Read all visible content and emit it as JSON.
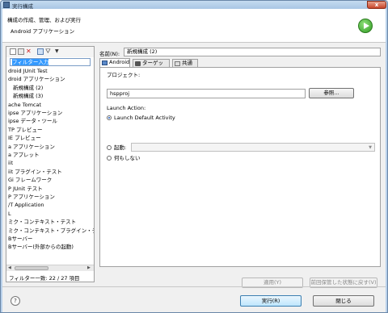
{
  "window": {
    "title": "実行構成",
    "close_symbol": "x"
  },
  "header": {
    "title": "構成の作成、管理、および実行",
    "subtitle": "Android アプリケーション"
  },
  "left": {
    "filter_placeholder": "フィルター入力",
    "tree_items": [
      {
        "label": "droid JUnit Test",
        "sub": false
      },
      {
        "label": "droid アプリケーション",
        "sub": false
      },
      {
        "label": "新規構成 (2)",
        "sub": true
      },
      {
        "label": "新規構成 (3)",
        "sub": true
      },
      {
        "label": "ache Tomcat",
        "sub": false
      },
      {
        "label": "ipse アプリケーション",
        "sub": false
      },
      {
        "label": "ipse データ・ツール",
        "sub": false
      },
      {
        "label": "TP プレビュー",
        "sub": false
      },
      {
        "label": "IE プレビュー",
        "sub": false
      },
      {
        "label": "a アプリケーション",
        "sub": false
      },
      {
        "label": "a アプレット",
        "sub": false
      },
      {
        "label": "iit",
        "sub": false
      },
      {
        "label": "iit プラグイン・テスト",
        "sub": false
      },
      {
        "label": "Gi フレームワーク",
        "sub": false
      },
      {
        "label": "P JUnit テスト",
        "sub": false
      },
      {
        "label": "P アプリケーション",
        "sub": false
      },
      {
        "label": "/T Application",
        "sub": false
      },
      {
        "label": "L",
        "sub": false
      },
      {
        "label": "ミク・コンテキスト・テスト",
        "sub": false
      },
      {
        "label": "ミク・コンテキスト・プラグイン・テス",
        "sub": false
      },
      {
        "label": "Bサーバー",
        "sub": false
      },
      {
        "label": "Bサーバー(外部からの起動)",
        "sub": false
      }
    ],
    "filter_count": "フィルター一致: 22 / 27 項目"
  },
  "right": {
    "name_label": "名前(N):",
    "name_value": "新規構成 (2)",
    "tabs": [
      {
        "label": "Android"
      },
      {
        "label": "ターゲット"
      },
      {
        "label": "共通(C)"
      }
    ],
    "project_label": "プロジェクト:",
    "project_value": "hspproj",
    "browse_label": "参照...",
    "launch_action_label": "Launch Action:",
    "radio_default": "Launch Default Activity",
    "radio_launch": "起動:",
    "radio_nothing": "何もしない",
    "apply_label": "適用(Y)",
    "revert_label": "前回保管した状態に戻す(V)"
  },
  "footer": {
    "help_symbol": "?",
    "run_label": "実行(R)",
    "close_label": "閉じる"
  }
}
